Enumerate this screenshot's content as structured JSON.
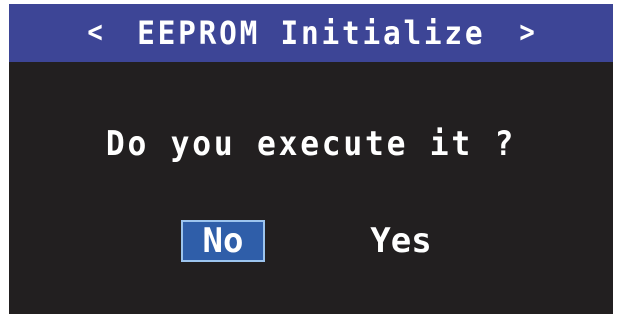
{
  "header": {
    "title": "EEPROM Initialize",
    "prev_arrow": "<",
    "next_arrow": ">"
  },
  "dialog": {
    "prompt": "Do you execute it ?",
    "no_label": "No",
    "yes_label": "Yes",
    "selected": "No"
  },
  "colors": {
    "title_bar": "#3d4596",
    "background": "#221f20",
    "selected_button": "#2f5ea9",
    "selected_border": "#9cc4ee",
    "text": "#ffffff"
  }
}
